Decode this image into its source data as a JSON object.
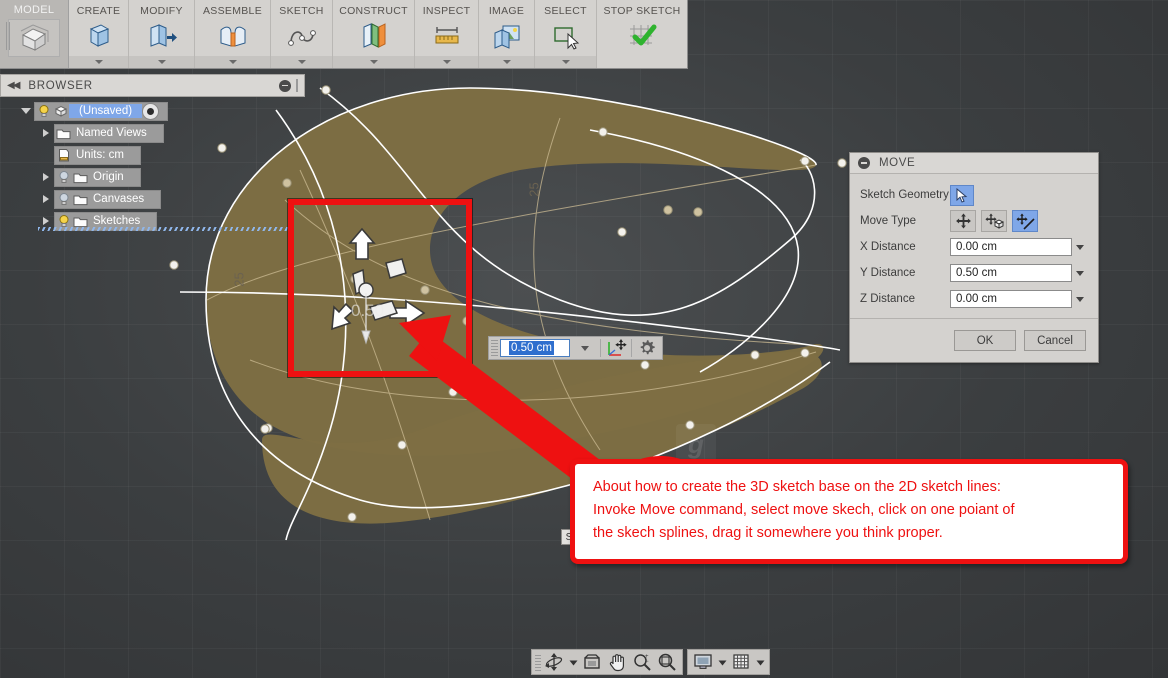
{
  "app": {
    "ribbon": {
      "model_tab": {
        "label": "MODEL",
        "icon": "cube-icon"
      },
      "panels": [
        {
          "label": "CREATE",
          "icon": "box-create-icon",
          "has_dropdown": true
        },
        {
          "label": "MODIFY",
          "icon": "modify-press-pull-icon",
          "has_dropdown": true
        },
        {
          "label": "ASSEMBLE",
          "icon": "assemble-joint-icon",
          "has_dropdown": true
        },
        {
          "label": "SKETCH",
          "icon": "spline-icon",
          "has_dropdown": true
        },
        {
          "label": "CONSTRUCT",
          "icon": "construct-plane-icon",
          "has_dropdown": true
        },
        {
          "label": "INSPECT",
          "icon": "measure-ruler-icon",
          "has_dropdown": true
        },
        {
          "label": "IMAGE",
          "icon": "image-capture-icon",
          "has_dropdown": true
        },
        {
          "label": "SELECT",
          "icon": "select-window-icon",
          "has_dropdown": true
        },
        {
          "label": "STOP SKETCH",
          "icon": "green-check-grid-icon",
          "has_dropdown": false
        }
      ]
    },
    "browser": {
      "title": "BROWSER",
      "collapse_icon": "double-chevron-left-icon",
      "minimize_icon": "circle-minus-icon",
      "tree": [
        {
          "label": "(Unsaved)",
          "expander": "down",
          "icons": [
            "lightbulb-on-icon",
            "document-cube-icon"
          ],
          "selected": true,
          "trailing_icon": "visibility-radio-icon",
          "indent": 0
        },
        {
          "label": "Named Views",
          "expander": "right",
          "icons": [
            "folder-icon"
          ],
          "selected": false,
          "indent": 1
        },
        {
          "label": "Units: cm",
          "expander": "none",
          "icons": [
            "units-ruler-icon"
          ],
          "selected": false,
          "indent": 1
        },
        {
          "label": "Origin",
          "expander": "right",
          "icons": [
            "lightbulb-off-icon",
            "folder-icon"
          ],
          "selected": false,
          "indent": 1
        },
        {
          "label": "Canvases",
          "expander": "right",
          "icons": [
            "lightbulb-off-icon",
            "folder-icon"
          ],
          "selected": false,
          "indent": 1
        },
        {
          "label": "Sketches",
          "expander": "right",
          "icons": [
            "lightbulb-on-icon",
            "folder-icon"
          ],
          "selected": false,
          "indent": 1,
          "underlined": true
        }
      ]
    },
    "move_dialog": {
      "title": "MOVE",
      "collapse_icon": "circle-minus-icon",
      "rows": {
        "sketch_geometry_label": "Sketch Geometry",
        "sketch_geometry_button_icon": "mouse-cursor-icon",
        "move_type_label": "Move Type",
        "move_type_buttons": [
          {
            "icon": "free-move-icon",
            "selected": false
          },
          {
            "icon": "move-object-icon",
            "selected": false
          },
          {
            "icon": "move-along-line-icon",
            "selected": true
          }
        ],
        "x_label": "X Distance",
        "x_value": "0.00 cm",
        "y_label": "Y Distance",
        "y_value": "0.50 cm",
        "z_label": "Z Distance",
        "z_value": "0.00 cm"
      },
      "ok_label": "OK",
      "cancel_label": "Cancel"
    },
    "inline_input": {
      "value": "0.50 cm",
      "dropdown_icon": "chevron-down-icon",
      "axis_icon": "coordinate-axes-move-icon",
      "settings_icon": "gear-icon"
    },
    "viewport": {
      "dimension_label": "25",
      "small_chip_label": "S",
      "manipulator_value": "0.50",
      "watermark_glyph": "g"
    },
    "callout": {
      "line1": "About how to create the 3D sketch base on the 2D sketch lines:",
      "line2": "Invoke Move command, select move skech, click on one poiant of",
      "line3": "the skech splines, drag it somewhere you think proper."
    },
    "navbar": {
      "buttons": [
        {
          "icon": "orbit-icon",
          "has_caret": true
        },
        {
          "icon": "look-at-icon",
          "has_caret": false
        },
        {
          "icon": "pan-hand-icon",
          "has_caret": false
        },
        {
          "icon": "zoom-plusminus-icon",
          "has_caret": false
        },
        {
          "icon": "zoom-fit-icon",
          "has_caret": false
        }
      ],
      "buttons2": [
        {
          "icon": "display-settings-icon",
          "has_caret": true
        },
        {
          "icon": "grid-snap-icon",
          "has_caret": true
        }
      ]
    },
    "colors": {
      "accent_red": "#ee1111",
      "selection_blue": "#7fa7e8",
      "sketch_fill": "#7e6e43",
      "viewport_bg": "#424547",
      "panel_bg": "#d4d2cf"
    }
  }
}
